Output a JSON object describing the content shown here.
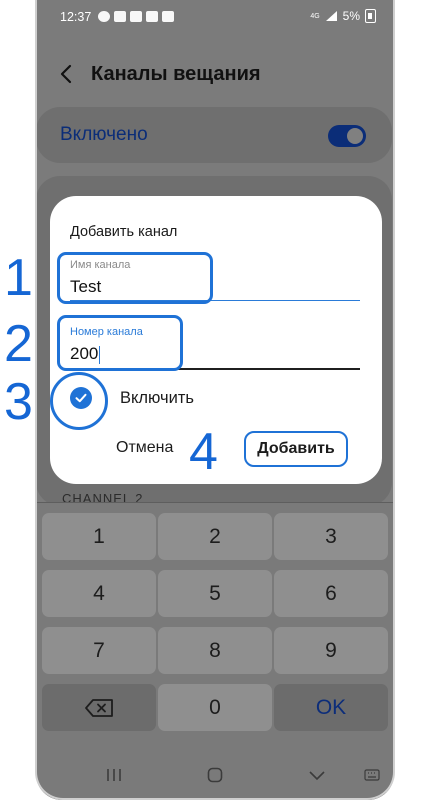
{
  "status_bar": {
    "time": "12:37",
    "network": "4G",
    "battery": "5%"
  },
  "header": {
    "title": "Каналы вещания"
  },
  "master_switch": {
    "label": "Включено",
    "on": true
  },
  "peek": {
    "text": "CHANNEL 2"
  },
  "dialog": {
    "title": "Добавить канал",
    "name_field": {
      "label": "Имя канала",
      "value": "Test"
    },
    "number_field": {
      "label": "Номер канала",
      "value": "200"
    },
    "enable_checkbox": {
      "label": "Включить",
      "checked": true
    },
    "cancel_label": "Отмена",
    "add_label": "Добавить"
  },
  "steps": [
    "1",
    "2",
    "3",
    "4"
  ],
  "keypad": {
    "keys": [
      "1",
      "2",
      "3",
      "4",
      "5",
      "6",
      "7",
      "8",
      "9",
      "",
      "0",
      "OK"
    ]
  },
  "colors": {
    "accent": "#1f72d6",
    "step_number": "#1566d4",
    "dim_text": "#0b2d78"
  }
}
